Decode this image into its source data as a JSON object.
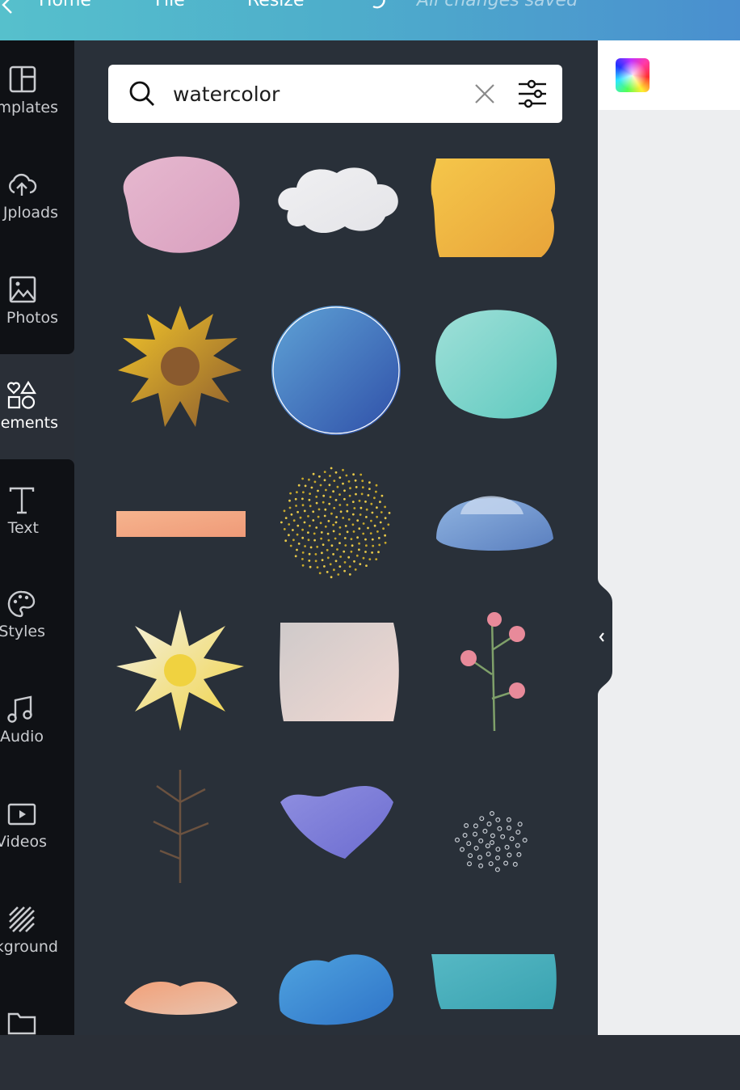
{
  "topbar": {
    "back_icon": "chevron-left-icon",
    "home_label": "Home",
    "file_label": "File",
    "resize_label": "Resize",
    "undo_icon": "undo-icon",
    "save_status": "All changes saved"
  },
  "sidebar": {
    "items": [
      {
        "label": "mplates",
        "icon": "templates-icon"
      },
      {
        "label": "Jploads",
        "icon": "upload-cloud-icon"
      },
      {
        "label": "Photos",
        "icon": "photo-icon"
      },
      {
        "label": "ements",
        "icon": "elements-shapes-icon",
        "active": true
      },
      {
        "label": "Text",
        "icon": "text-icon"
      },
      {
        "label": "Styles",
        "icon": "palette-icon"
      },
      {
        "label": "Audio",
        "icon": "music-note-icon"
      },
      {
        "label": "Videos",
        "icon": "video-icon"
      },
      {
        "label": "kground",
        "icon": "background-stripes-icon"
      },
      {
        "label": "",
        "icon": "folder-icon"
      }
    ]
  },
  "search": {
    "value": "watercolor",
    "placeholder": "",
    "search_icon": "search-icon",
    "clear_icon": "close-icon",
    "filter_icon": "filter-sliders-icon"
  },
  "results": [
    {
      "name": "pink-watercolor-blob",
      "colors": [
        "#e6b8cf",
        "#d9a0bf"
      ]
    },
    {
      "name": "white-cloud",
      "colors": [
        "#f0f0f2",
        "#e4e4e8"
      ]
    },
    {
      "name": "yellow-watercolor-square",
      "colors": [
        "#f5c64a",
        "#e8a43a"
      ]
    },
    {
      "name": "sunflower",
      "colors": [
        "#f6c92a",
        "#8a5a2e"
      ]
    },
    {
      "name": "blue-watercolor-circle",
      "colors": [
        "#5fa3d6",
        "#2f4fa8"
      ]
    },
    {
      "name": "teal-watercolor-blob",
      "colors": [
        "#9fe0d8",
        "#5fc9bf"
      ]
    },
    {
      "name": "peach-brush-stroke",
      "colors": [
        "#f6b48e",
        "#ef9a78"
      ]
    },
    {
      "name": "gold-glitter-splatter",
      "colors": [
        "#e8c94a",
        "#c8a82a"
      ]
    },
    {
      "name": "ufo-spaceship",
      "colors": [
        "#8fb3e0",
        "#5a7fbf"
      ]
    },
    {
      "name": "daisy-flower",
      "colors": [
        "#f4f2e8",
        "#f0d240"
      ]
    },
    {
      "name": "grey-pink-wash",
      "colors": [
        "#cfcaca",
        "#f0d8d2"
      ]
    },
    {
      "name": "pink-flower-branch",
      "colors": [
        "#e88a9a",
        "#7fa06a"
      ]
    },
    {
      "name": "brown-twig-branch",
      "colors": [
        "#6b5240",
        "#6b5240"
      ]
    },
    {
      "name": "purple-watercolor-splash",
      "colors": [
        "#8f8fe0",
        "#6c6cd0"
      ]
    },
    {
      "name": "white-dots-spray",
      "colors": [
        "#c8cdd4",
        "#c8cdd4"
      ]
    },
    {
      "name": "floral-bouquet",
      "colors": [
        "#f2a078",
        "#e8c4b0"
      ]
    },
    {
      "name": "blue-watercolor-splash",
      "colors": [
        "#4fa3df",
        "#2f74c8"
      ]
    },
    {
      "name": "teal-brush-stroke",
      "colors": [
        "#56b8c4",
        "#3aa3b1"
      ]
    }
  ],
  "canvas": {
    "color_picker_icon": "color-picker-icon",
    "collapse_icon": "chevron-left-icon"
  }
}
